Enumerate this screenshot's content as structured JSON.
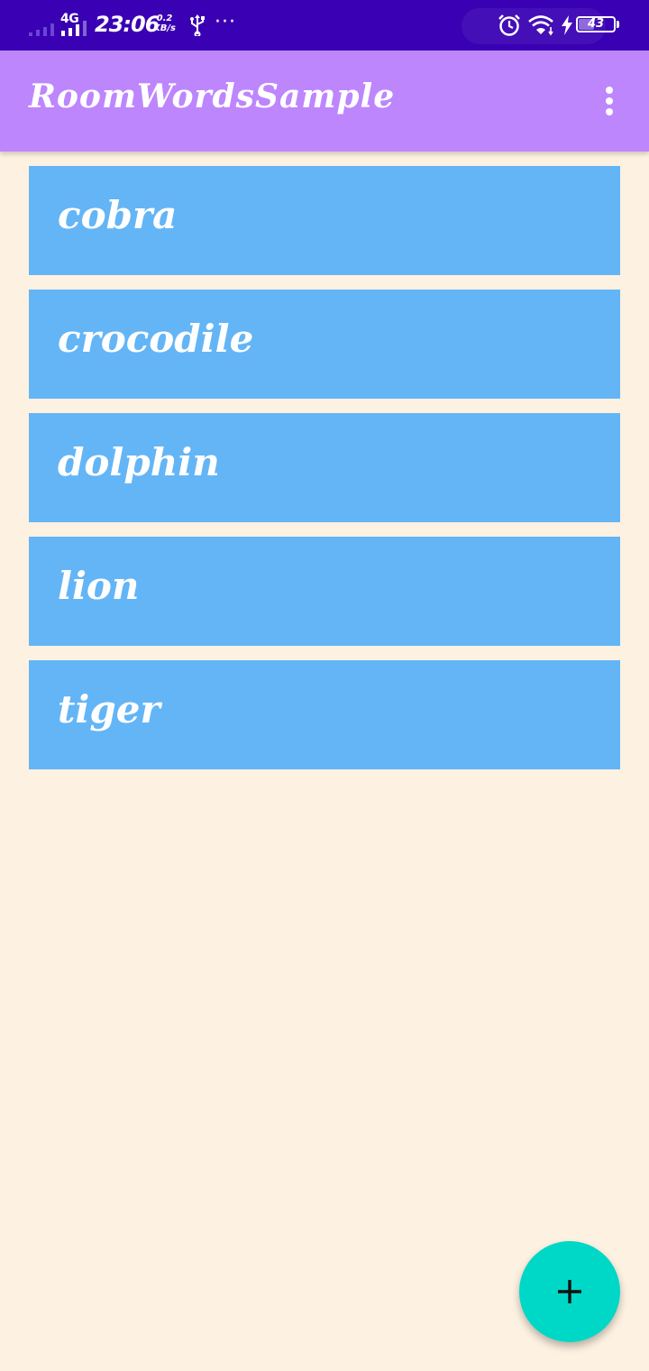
{
  "status_bar": {
    "network_type": "4G",
    "time": "23:06",
    "net_speed_value": "0.2",
    "net_speed_unit": "KB/s",
    "more_indicator": "···",
    "battery_level": "43",
    "battery_fraction": 0.43,
    "icons": [
      "signal-icon",
      "usb-icon",
      "alarm-icon",
      "wifi-icon",
      "charging-icon",
      "battery-icon"
    ]
  },
  "app_bar": {
    "title": "RoomWordsSample",
    "overflow_icon": "more-vert-icon"
  },
  "words": [
    "cobra",
    "crocodile",
    "dolphin",
    "lion",
    "tiger"
  ],
  "fab": {
    "icon": "add-icon"
  },
  "colors": {
    "status_bar": "#3a00b3",
    "app_bar": "#bd86fd",
    "background": "#fdf1e1",
    "list_item": "#64b5f6",
    "fab": "#00d8c7"
  }
}
